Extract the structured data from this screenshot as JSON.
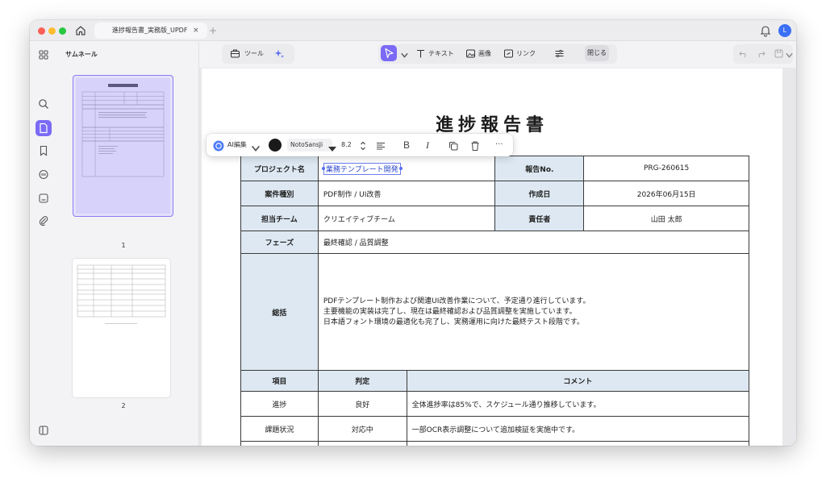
{
  "window": {
    "tab_title": "進捗報告書_実務版_UPDF",
    "tab_close": "×",
    "tab_add": "+",
    "avatar_letter": "L"
  },
  "thumbnails": {
    "title": "サムネール",
    "pages": [
      "1",
      "2"
    ]
  },
  "toolbar": {
    "tools_label": "ツール",
    "text_label": "テキスト",
    "image_label": "画像",
    "link_label": "リンク",
    "close_label": "閉じる"
  },
  "format_bar": {
    "ai_edit_label": "AI編集",
    "font_name": "NotoSansJi",
    "font_size": "8.2",
    "bold_glyph": "B",
    "italic_glyph": "I",
    "more_glyph": "···"
  },
  "document": {
    "title": "進捗報告書",
    "info_rows": [
      {
        "label1": "プロジェクト名",
        "value1": "業務テンプレート開発",
        "label2": "報告No.",
        "value2": "PRG-260615"
      },
      {
        "label1": "案件種別",
        "value1": "PDF制作 / UI改善",
        "label2": "作成日",
        "value2": "2026年06月15日"
      },
      {
        "label1": "担当チーム",
        "value1": "クリエイティブチーム",
        "label2": "責任者",
        "value2": "山田 太郎"
      }
    ],
    "phase": {
      "label": "フェーズ",
      "value": "最終確認 / 品質調整"
    },
    "summary": {
      "label": "総括",
      "lines": [
        "PDFテンプレート制作および関連UI改善作業について、予定通り進行しています。",
        "主要機能の実装は完了し、現在は最終確認および品質調整を実施しています。",
        "日本語フォント環境の最適化も完了し、実務運用に向けた最終テスト段階です。"
      ]
    },
    "eval_headers": {
      "item": "項目",
      "judgment": "判定",
      "comment": "コメント"
    },
    "eval_rows": [
      {
        "item": "進捗",
        "judgment": "良好",
        "comment": "全体進捗率は85%で、スケジュール通り推移しています。"
      },
      {
        "item": "課題状況",
        "judgment": "対応中",
        "comment": "一部OCR表示調整について追加検証を実施中です。"
      }
    ]
  },
  "colors": {
    "accent": "#7a6af5",
    "table_header_bg": "#dde8f2",
    "selection": "#6d7ef0"
  }
}
